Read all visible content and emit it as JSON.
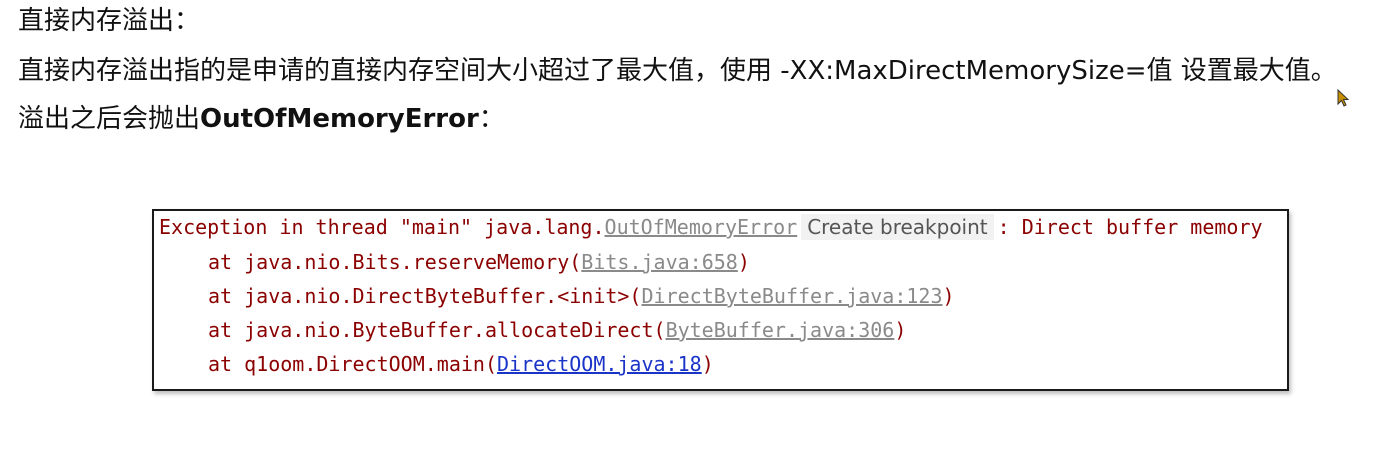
{
  "doc": {
    "heading": "直接内存溢出：",
    "line2": "直接内存溢出指的是申请的直接内存空间大小超过了最大值，使用 -XX:MaxDirectMemorySize=值 设置最大值。",
    "line3_prefix": "溢出之后会抛出",
    "line3_bold": "OutOfMemoryError",
    "line3_suffix": "："
  },
  "console": {
    "exception_prefix": "Exception in thread \"main\" java.lang.",
    "exception_class": "OutOfMemoryError",
    "breakpoint_label": "Create breakpoint",
    "exception_suffix": ": Direct buffer memory",
    "frames": [
      {
        "prefix": "at java.nio.Bits.reserveMemory(",
        "link": "Bits.java:658",
        "suffix": ")"
      },
      {
        "prefix": "at java.nio.DirectByteBuffer.<init>(",
        "link": "DirectByteBuffer.java:123",
        "suffix": ")"
      },
      {
        "prefix": "at java.nio.ByteBuffer.allocateDirect(",
        "link": "ByteBuffer.java:306",
        "suffix": ")"
      },
      {
        "prefix": "at q1oom.DirectOOM.main(",
        "link": "DirectOOM.java:18",
        "suffix": ")"
      }
    ]
  },
  "colors": {
    "console_text": "#8b0000",
    "link_gray": "#8a8a8a",
    "link_blue": "#1a34c8"
  },
  "icons": [
    "mouse-cursor-icon"
  ]
}
